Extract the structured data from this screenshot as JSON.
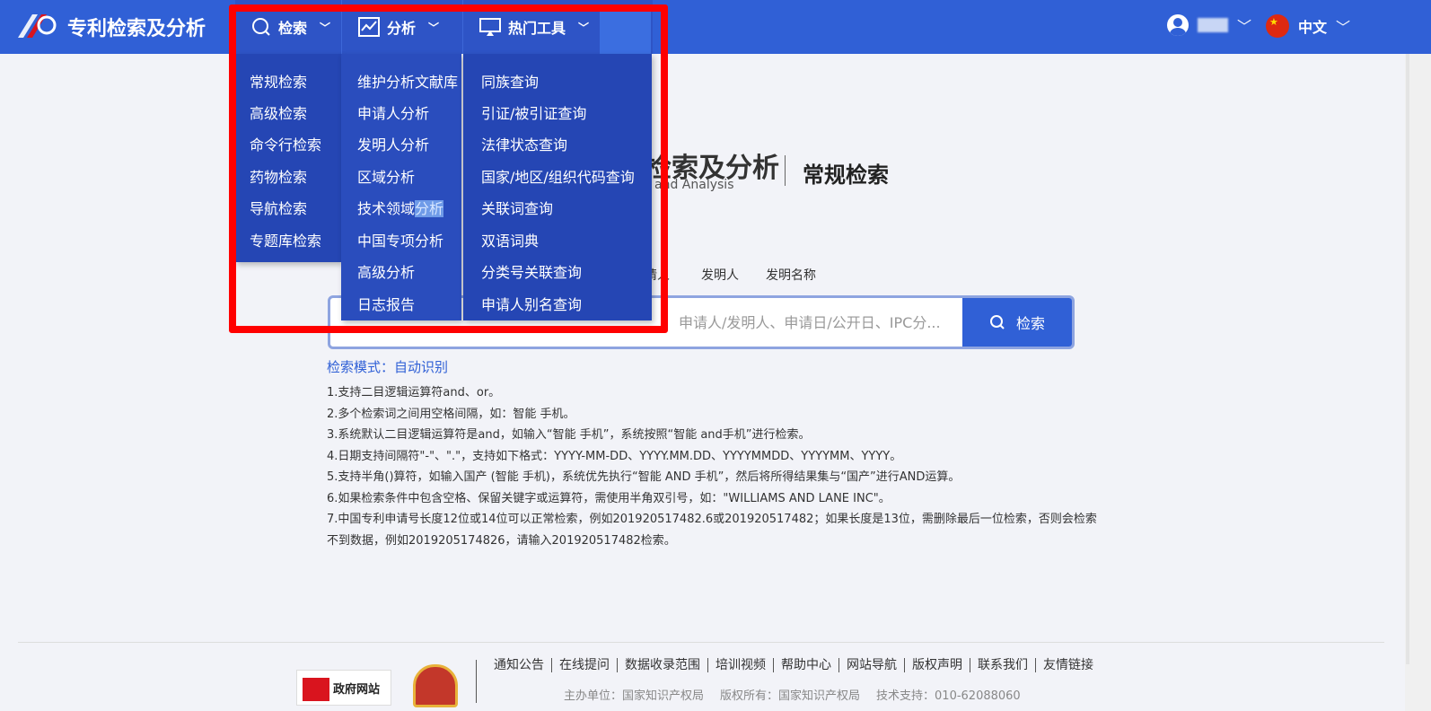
{
  "header": {
    "app_title": "专利检索及分析",
    "nav": {
      "search": "检索",
      "analysis": "分析",
      "tools": "热门工具"
    },
    "language": "中文"
  },
  "dropdowns": {
    "search_items": [
      "常规检索",
      "高级检索",
      "命令行检索",
      "药物检索",
      "导航检索",
      "专题库检索"
    ],
    "analysis_items": [
      "维护分析文献库",
      "申请人分析",
      "发明人分析",
      "区域分析",
      "技术领域",
      "分析",
      "中国专项分析",
      "高级分析",
      "日志报告"
    ],
    "tools_items": [
      "同族查询",
      "引证/被引证查询",
      "法律状态查询",
      "国家/地区/组织代码查询",
      "关联词查询",
      "双语词典",
      "分类号关联查询",
      "申请人别名查询"
    ]
  },
  "main": {
    "brand_title": "检索及分析",
    "brand_sub": "ch and Analysis",
    "page_heading": "常规检索",
    "tabs": [
      "请人",
      "发明人",
      "发明名称"
    ],
    "search_placeholder": "申请人/发明人、申请日/公开日、IPC分...",
    "search_button": "检索",
    "mode_label": "检索模式：自动识别",
    "tips": [
      "1.支持二目逻辑运算符and、or。",
      "2.多个检索词之间用空格间隔，如：智能 手机。",
      "3.系统默认二目逻辑运算符是and，如输入“智能 手机”，系统按照“智能 and手机”进行检索。",
      "4.日期支持间隔符\"-\"、\".\"，支持如下格式：YYYY-MM-DD、YYYY.MM.DD、YYYYMMDD、YYYYMM、YYYY。",
      "5.支持半角()算符，如输入国产 (智能 手机)，系统优先执行“智能 AND 手机”，然后将所得结果集与“国产”进行AND运算。",
      "6.如果检索条件中包含空格、保留关键字或运算符，需使用半角双引号，如：\"WILLIAMS AND LANE INC\"。",
      "7.中国专利申请号长度12位或14位可以正常检索，例如201920517482.6或201920517482；如果长度是13位，需删除最后一位检索，否则会检索",
      "不到数据，例如2019205174826，请输入201920517482检索。"
    ]
  },
  "footer": {
    "gov_badge": "政府网站",
    "links": [
      "通知公告",
      "在线提问",
      "数据收录范围",
      "培训视频",
      "帮助中心",
      "网站导航",
      "版权声明",
      "联系我们",
      "友情链接"
    ],
    "host": "主办单位：国家知识产权局",
    "copyright": "版权所有：国家知识产权局",
    "support": "技术支持：010-62088060"
  },
  "colors": {
    "header_bg": "#3060d6",
    "dropdown_bg": "#2546b4",
    "highlight_frame": "#ff0000"
  }
}
